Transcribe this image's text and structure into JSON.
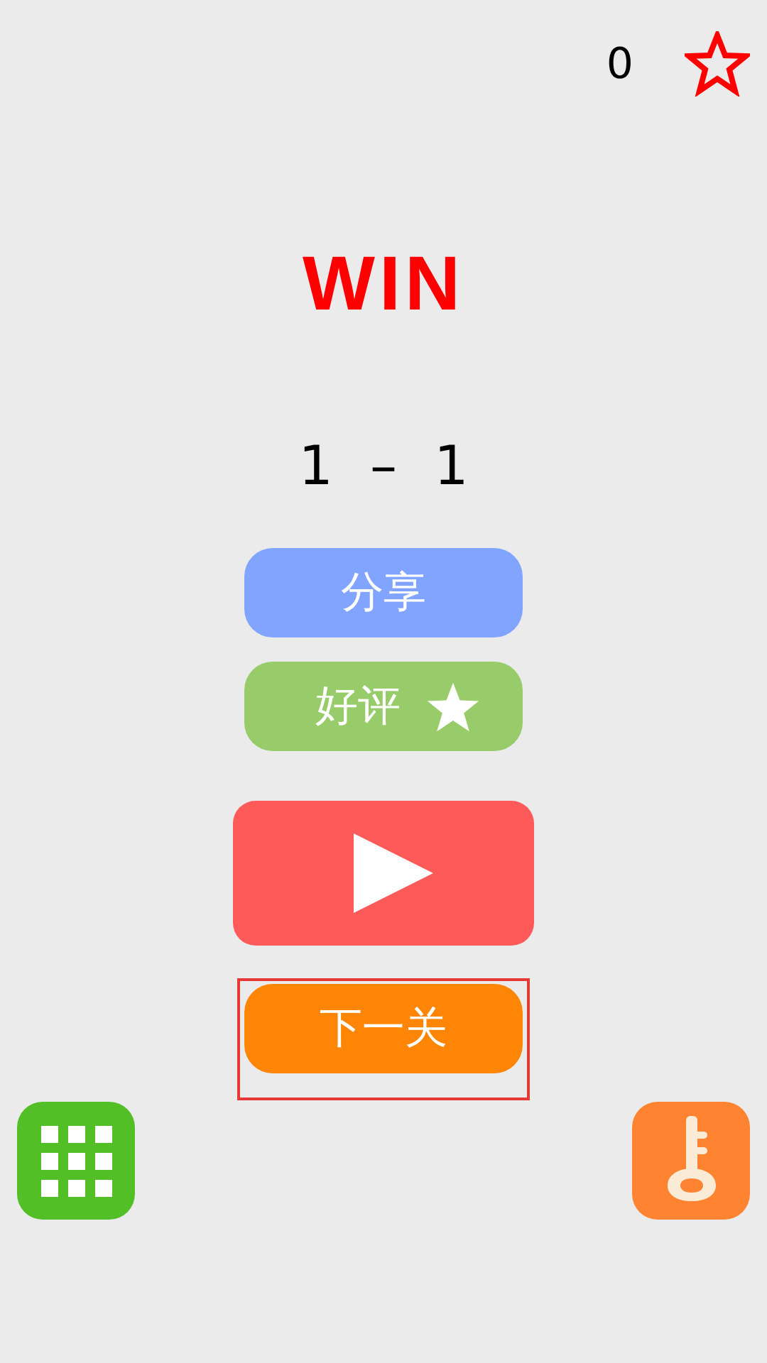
{
  "score": "0",
  "result": "WIN",
  "level": "1 – 1",
  "buttons": [
    {
      "kind": "share",
      "label": "分享"
    },
    {
      "kind": "rate",
      "label": "好评"
    },
    {
      "kind": "play"
    },
    {
      "kind": "next",
      "label": "下一关",
      "highlighted": true
    }
  ],
  "bottom": [
    {
      "kind": "levels"
    },
    {
      "kind": "key"
    }
  ]
}
